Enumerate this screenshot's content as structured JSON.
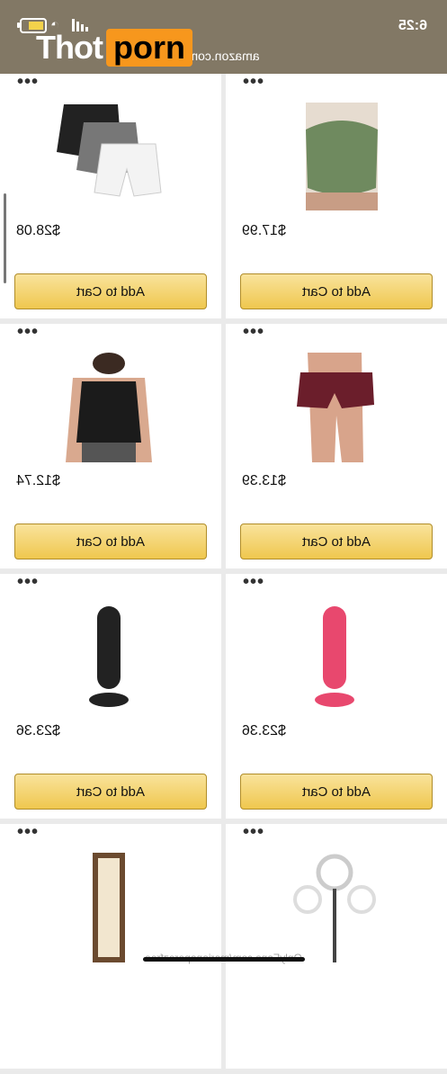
{
  "status": {
    "time": "6:25",
    "url": "amazon.com"
  },
  "watermark": {
    "part1": "Thot",
    "part2": "porn"
  },
  "footer_watermark": "OnlyFans.com/marianaperezfree",
  "products": [
    {
      "price": "$17.99",
      "cart": "Add to Cart",
      "icon": "green-shorts"
    },
    {
      "price": "$28.08",
      "cart": "Add to Cart",
      "icon": "shorts-3pack"
    },
    {
      "price": "$13.39",
      "cart": "Add to Cart",
      "icon": "burgundy-shorts"
    },
    {
      "price": "$12.74",
      "cart": "Add to Cart",
      "icon": "black-crop-top"
    },
    {
      "price": "$23.36",
      "cart": "Add to Cart",
      "icon": "pink-product"
    },
    {
      "price": "$23.36",
      "cart": "Add to Cart",
      "icon": "black-product"
    },
    {
      "icon": "ring-light-tripod"
    },
    {
      "icon": "floor-lamp"
    }
  ],
  "colors": {
    "header_bg": "#827865",
    "button_bg": "#efc74e",
    "brand_orange": "#f7971d"
  }
}
